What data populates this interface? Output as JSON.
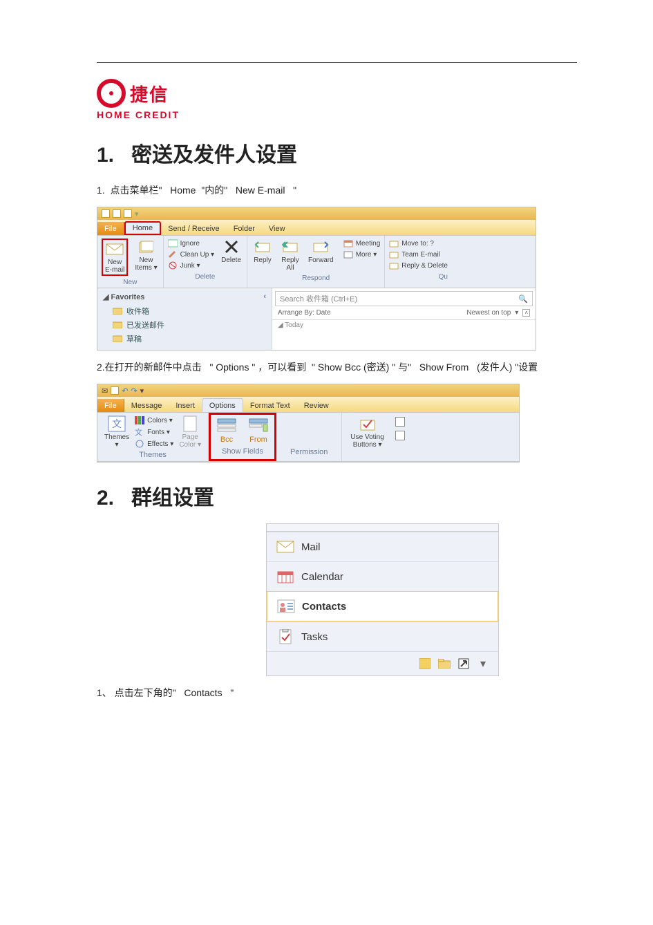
{
  "logo": {
    "cn": "捷信",
    "en": "HOME CREDIT"
  },
  "s1": {
    "num": "1.",
    "title": "密送及发件人设置",
    "step1": {
      "num": "1.",
      "a": "点击菜单栏\"",
      "b": "Home",
      "c": "\"内的\"",
      "d": "New E-mail",
      "e": "\""
    },
    "step2": {
      "a": "2.在打开的新邮件中点击",
      "b": "\"  Options  \"",
      "c": "，可以看到",
      "d": "\" Show Bcc  (密送) \"",
      "e": "与\"",
      "f": "Show From",
      "g": "(发件人) \"设置"
    }
  },
  "shot1": {
    "tabs": {
      "file": "File",
      "home": "Home",
      "sr": "Send / Receive",
      "folder": "Folder",
      "view": "View"
    },
    "new": {
      "email": "New\nE-mail",
      "items": "New\nItems ▾",
      "grp": "New"
    },
    "del": {
      "ignore": "Ignore",
      "clean": "Clean Up ▾",
      "junk": "Junk ▾",
      "delete": "Delete",
      "grp": "Delete"
    },
    "resp": {
      "reply": "Reply",
      "replyall": "Reply\nAll",
      "forward": "Forward",
      "meeting": "Meeting",
      "more": "More ▾",
      "grp": "Respond"
    },
    "quick": {
      "move": "Move to: ?",
      "team": "Team E-mail",
      "rd": "Reply & Delete",
      "grp": "Qu"
    },
    "nav": {
      "fav": "Favorites",
      "inbox": "收件箱",
      "sent": "已发送邮件",
      "draft": "草稿"
    },
    "search": "Search 收件箱 (Ctrl+E)",
    "arrange": {
      "by": "Arrange By: Date",
      "sort": "Newest on top"
    },
    "today": "Today"
  },
  "shot2": {
    "tabs": {
      "file": "File",
      "message": "Message",
      "insert": "Insert",
      "options": "Options",
      "format": "Format Text",
      "review": "Review"
    },
    "themes": {
      "btn": "Themes\n▾",
      "colors": "Colors ▾",
      "fonts": "Fonts ▾",
      "effects": "Effects ▾",
      "page": "Page\nColor ▾",
      "grp": "Themes"
    },
    "show": {
      "bcc": "Bcc",
      "from": "From",
      "grp": "Show Fields"
    },
    "perm": "Permission",
    "track": {
      "vote": "Use Voting\nButtons ▾"
    }
  },
  "s2": {
    "num": "2.",
    "title": "群组设置",
    "step1": {
      "a": "1、 点击左下角的\"",
      "b": "Contacts",
      "c": "\""
    }
  },
  "shot3": {
    "mail": "Mail",
    "cal": "Calendar",
    "contacts": "Contacts",
    "tasks": "Tasks"
  }
}
